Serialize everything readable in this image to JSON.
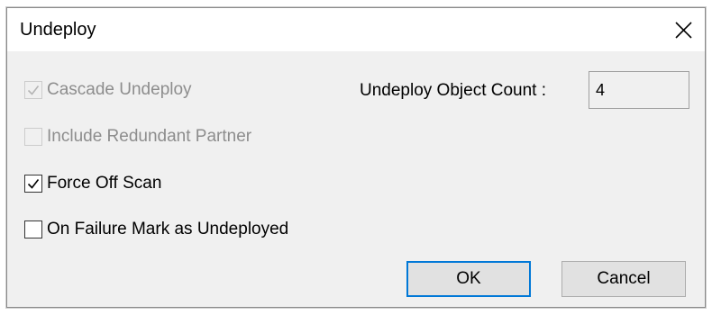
{
  "dialog": {
    "title": "Undeploy",
    "close_symbol": "close-icon"
  },
  "options": [
    {
      "label": "Cascade Undeploy",
      "checked": true,
      "enabled": false
    },
    {
      "label": "Include Redundant Partner",
      "checked": false,
      "enabled": false
    },
    {
      "label": "Force Off Scan",
      "checked": true,
      "enabled": true
    },
    {
      "label": "On Failure Mark as Undeployed",
      "checked": false,
      "enabled": true
    }
  ],
  "object_count": {
    "label": "Undeploy Object Count :",
    "value": "4"
  },
  "buttons": {
    "ok_label": "OK",
    "cancel_label": "Cancel"
  },
  "colors": {
    "accent": "#0078d7",
    "disabled_text": "#8d8d8d",
    "dialog_background": "#f0f0f0"
  }
}
